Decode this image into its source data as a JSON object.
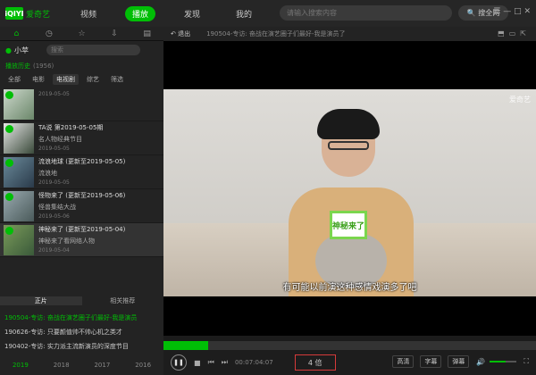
{
  "app": {
    "logo": "iQIYI",
    "name": "爱奇艺"
  },
  "nav": {
    "tabs": [
      "视频",
      "播放",
      "发现",
      "我的"
    ],
    "active": 1
  },
  "search": {
    "placeholder": "请输入搜索内容",
    "button": "搜全网"
  },
  "left": {
    "user": "小苹",
    "search_placeholder": "搜索",
    "album": {
      "name": "播放历史",
      "count": "(1956)"
    },
    "filters": [
      "全部",
      "电影",
      "电视剧",
      "综艺",
      "筛选"
    ],
    "items": [
      {
        "title": "",
        "date": "2019-05-05",
        "desc": ""
      },
      {
        "title": "TA说 第2019-05-05期",
        "date": "2019-05-05",
        "desc": "名人物经典节目"
      },
      {
        "title": "流浪地球 (更新至2019-05-05)",
        "date": "2019-05-05",
        "desc": "流浪地"
      },
      {
        "title": "怪物来了 (更新至2019-05-06)",
        "date": "2019-05-06",
        "desc": "怪兽集结大战"
      },
      {
        "title": "神秘来了 (更新至2019-05-04)",
        "date": "2019-05-04",
        "desc": "神秘来了看网络人物"
      }
    ],
    "tabs": [
      "正片",
      "相关推荐"
    ],
    "bottom_list": [
      "190504-专访: 奋战在演艺圈子们最好-我是演员",
      "190626-专访: 只要颜值帅不帅心机之类才",
      "190402-专访: 实力派主流新演员的深度节目"
    ],
    "years": [
      "2019",
      "2018",
      "2017",
      "2016"
    ]
  },
  "player": {
    "back": "退出",
    "title": "190504-专访: 奋战在演艺圈子们最好-我是演员了",
    "watermark": "爱奇艺",
    "card_text": "神秘来了",
    "subtitle": "有可能以前演这种感情戏演多了吧",
    "time": "00:07:04:07",
    "quality_label": "4 倍",
    "options": [
      "高清",
      "字幕",
      "弹幕"
    ],
    "progress_fraction": 0.12,
    "volume_fraction": 0.6
  },
  "icons": {
    "home": "home-icon",
    "history": "clock-icon",
    "favorite": "star-icon",
    "download": "download-icon",
    "settings": "settings-icon"
  }
}
